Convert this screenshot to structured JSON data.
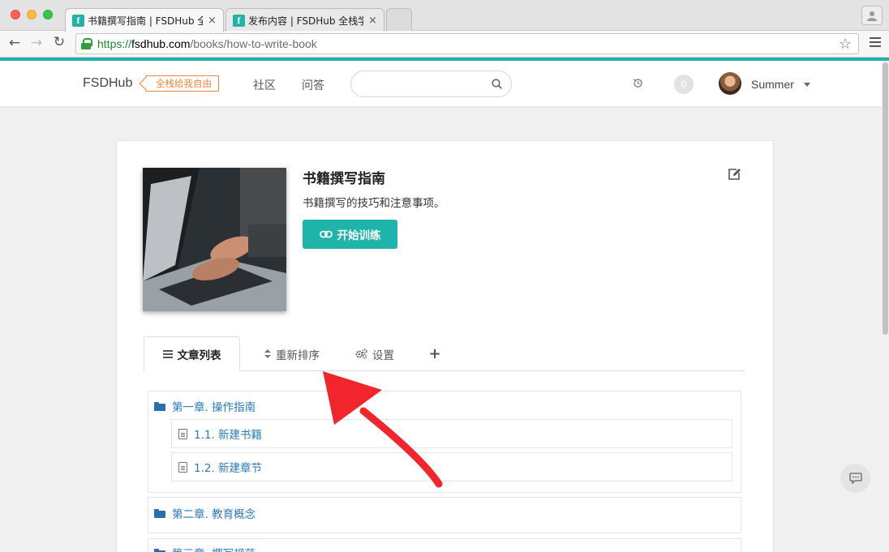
{
  "browser": {
    "tabs": [
      {
        "favicon": "f",
        "title": "书籍撰写指南 | FSDHub 全栈",
        "close": "×"
      },
      {
        "favicon": "f",
        "title": "发布内容 | FSDHub 全栈学院",
        "close": "×"
      }
    ],
    "url": {
      "scheme": "https://",
      "host": "fsdhub.com",
      "path": "/books/how-to-write-book"
    }
  },
  "header": {
    "logo": "FSDHub",
    "slogan": "全栈给我自由",
    "nav": [
      "社区",
      "问答"
    ],
    "search": {
      "value": "",
      "placeholder": ""
    },
    "notifications": "0",
    "username": "Summer"
  },
  "book": {
    "title": "书籍撰写指南",
    "description": "书籍撰写的技巧和注意事项。",
    "train_button": "开始训练"
  },
  "tabs": {
    "articles": "文章列表",
    "reorder": "重新排序",
    "settings": "设置",
    "add": "+"
  },
  "chapters": [
    {
      "title": "第一章. 操作指南",
      "sections": [
        "1.1. 新建书籍",
        "1.2. 新建章节"
      ]
    },
    {
      "title": "第二章. 教育概念",
      "sections": []
    },
    {
      "title": "第三章. 撰写规范",
      "sections": []
    }
  ],
  "colors": {
    "accent": "#20b2aa",
    "slogan": "#f0843c",
    "link": "#2a7ab8",
    "arrow": "#f0262c"
  }
}
